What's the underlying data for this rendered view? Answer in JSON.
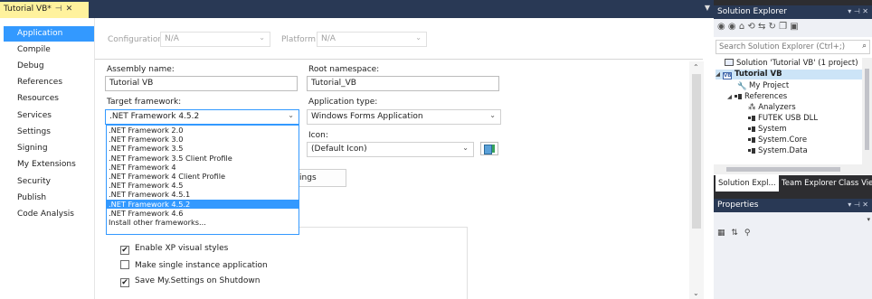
{
  "document_tab": {
    "title": "Tutorial VB*",
    "pin": "⊣",
    "close": "✕"
  },
  "side_nav": [
    {
      "label": "Application",
      "active": true
    },
    {
      "label": "Compile"
    },
    {
      "label": "Debug"
    },
    {
      "label": "References"
    },
    {
      "label": "Resources"
    },
    {
      "label": "Services"
    },
    {
      "label": "Settings"
    },
    {
      "label": "Signing"
    },
    {
      "label": "My Extensions"
    },
    {
      "label": "Security"
    },
    {
      "label": "Publish"
    },
    {
      "label": "Code Analysis"
    }
  ],
  "config": {
    "configuration_label": "Configuration:",
    "configuration_value": "N/A",
    "platform_label": "Platform:",
    "platform_value": "N/A"
  },
  "form": {
    "assembly_name_label": "Assembly name:",
    "assembly_name_value": "Tutorial VB",
    "root_namespace_label": "Root namespace:",
    "root_namespace_value": "Tutorial_VB",
    "target_framework_label": "Target framework:",
    "target_framework_value": ".NET Framework 4.5.2",
    "application_type_label": "Application type:",
    "application_type_value": "Windows Forms Application",
    "icon_label": "Icon:",
    "icon_value": "(Default Icon)",
    "settings_button_label": "ttings"
  },
  "framework_options": [
    {
      "label": ".NET Framework 2.0"
    },
    {
      "label": ".NET Framework 3.0"
    },
    {
      "label": ".NET Framework 3.5"
    },
    {
      "label": ".NET Framework 3.5 Client Profile"
    },
    {
      "label": ".NET Framework 4"
    },
    {
      "label": ".NET Framework 4 Client Profile"
    },
    {
      "label": ".NET Framework 4.5"
    },
    {
      "label": ".NET Framework 4.5.1"
    },
    {
      "label": ".NET Framework 4.5.2",
      "selected": true
    },
    {
      "label": ".NET Framework 4.6"
    },
    {
      "label": "Install other frameworks..."
    }
  ],
  "checkboxes": [
    {
      "label": "Enable XP visual styles",
      "checked": true,
      "mark": "✔"
    },
    {
      "label": "Make single instance application",
      "checked": false,
      "mark": ""
    },
    {
      "label": "Save My.Settings on Shutdown",
      "checked": true,
      "mark": "✔"
    }
  ],
  "solution_explorer": {
    "title": "Solution Explorer",
    "search_placeholder": "Search Solution Explorer (Ctrl+;)",
    "tree": [
      {
        "label": "Solution 'Tutorial VB' (1 project)",
        "icon": "solution-icon"
      },
      {
        "label": "Tutorial VB",
        "icon": "vb-project-icon",
        "bold": true
      },
      {
        "label": "My Project",
        "icon": "wrench-icon"
      },
      {
        "label": "References",
        "icon": "references-icon"
      },
      {
        "label": "Analyzers",
        "icon": "analyzer-icon"
      },
      {
        "label": "FUTEK USB DLL",
        "icon": "reference-icon"
      },
      {
        "label": "System",
        "icon": "reference-icon"
      },
      {
        "label": "System.Core",
        "icon": "reference-icon"
      },
      {
        "label": "System.Data",
        "icon": "reference-icon"
      }
    ],
    "tabs": [
      {
        "label": "Solution Expl...",
        "active": true
      },
      {
        "label": "Team Explorer"
      },
      {
        "label": "Class View"
      }
    ]
  },
  "properties": {
    "title": "Properties"
  },
  "colors": {
    "accent": "#3399ff",
    "title_bar": "#293955",
    "active_doc_tab": "#fff29d",
    "chrome_dark": "#2d2d30"
  }
}
